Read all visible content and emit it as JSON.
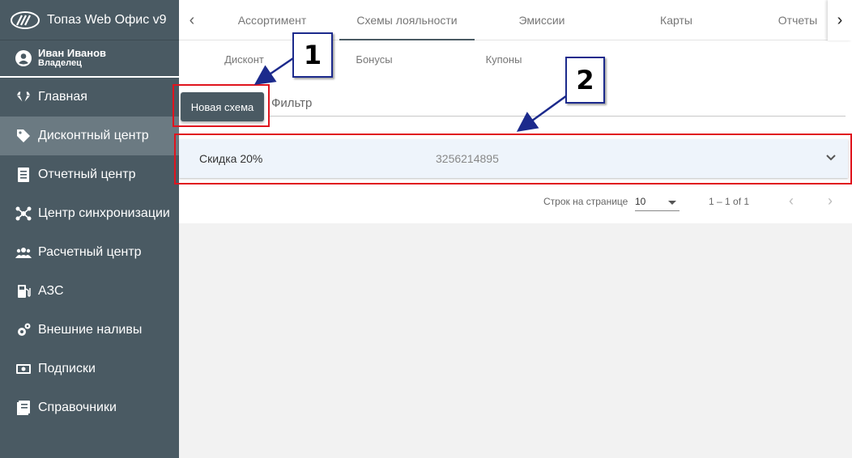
{
  "app": {
    "title": "Топаз Web Офис v9"
  },
  "user": {
    "name": "Иван Иванов",
    "role": "Владелец"
  },
  "sidebar": {
    "items": [
      {
        "label": "Главная",
        "icon": "diamond-icon",
        "active": false
      },
      {
        "label": "Дисконтный центр",
        "icon": "tag-icon",
        "active": true
      },
      {
        "label": "Отчетный центр",
        "icon": "report-icon",
        "active": false
      },
      {
        "label": "Центр синхронизации",
        "icon": "network-icon",
        "active": false
      },
      {
        "label": "Расчетный центр",
        "icon": "users-icon",
        "active": false
      },
      {
        "label": "АЗС",
        "icon": "fuel-pump-icon",
        "active": false
      },
      {
        "label": "Внешние наливы",
        "icon": "gears-icon",
        "active": false
      },
      {
        "label": "Подписки",
        "icon": "money-icon",
        "active": false
      },
      {
        "label": "Справочники",
        "icon": "book-icon",
        "active": false
      }
    ]
  },
  "top_tabs": [
    {
      "label": "Ассортимент"
    },
    {
      "label": "Схемы лояльности",
      "active": true
    },
    {
      "label": "Эмиссии"
    },
    {
      "label": "Карты"
    },
    {
      "label": "Отчеты"
    }
  ],
  "sub_tabs": [
    {
      "label": "Дисконт"
    },
    {
      "label": "Бонусы"
    },
    {
      "label": "Купоны"
    }
  ],
  "toolbar": {
    "new_label": "Новая схема",
    "filter_placeholder": "Фильтр"
  },
  "table": {
    "rows": [
      {
        "name": "Скидка 20%",
        "code": "3256214895"
      }
    ]
  },
  "pager": {
    "rows_label": "Строк на странице",
    "rows_value": "10",
    "range": "1 – 1 of 1"
  },
  "annotations": {
    "callout1": "1",
    "callout2": "2"
  },
  "colors": {
    "sidebar": "#4a5a63",
    "sidebar_active": "#6b7a82",
    "highlight": "#e0141e",
    "callout_border": "#1c2a8c"
  }
}
